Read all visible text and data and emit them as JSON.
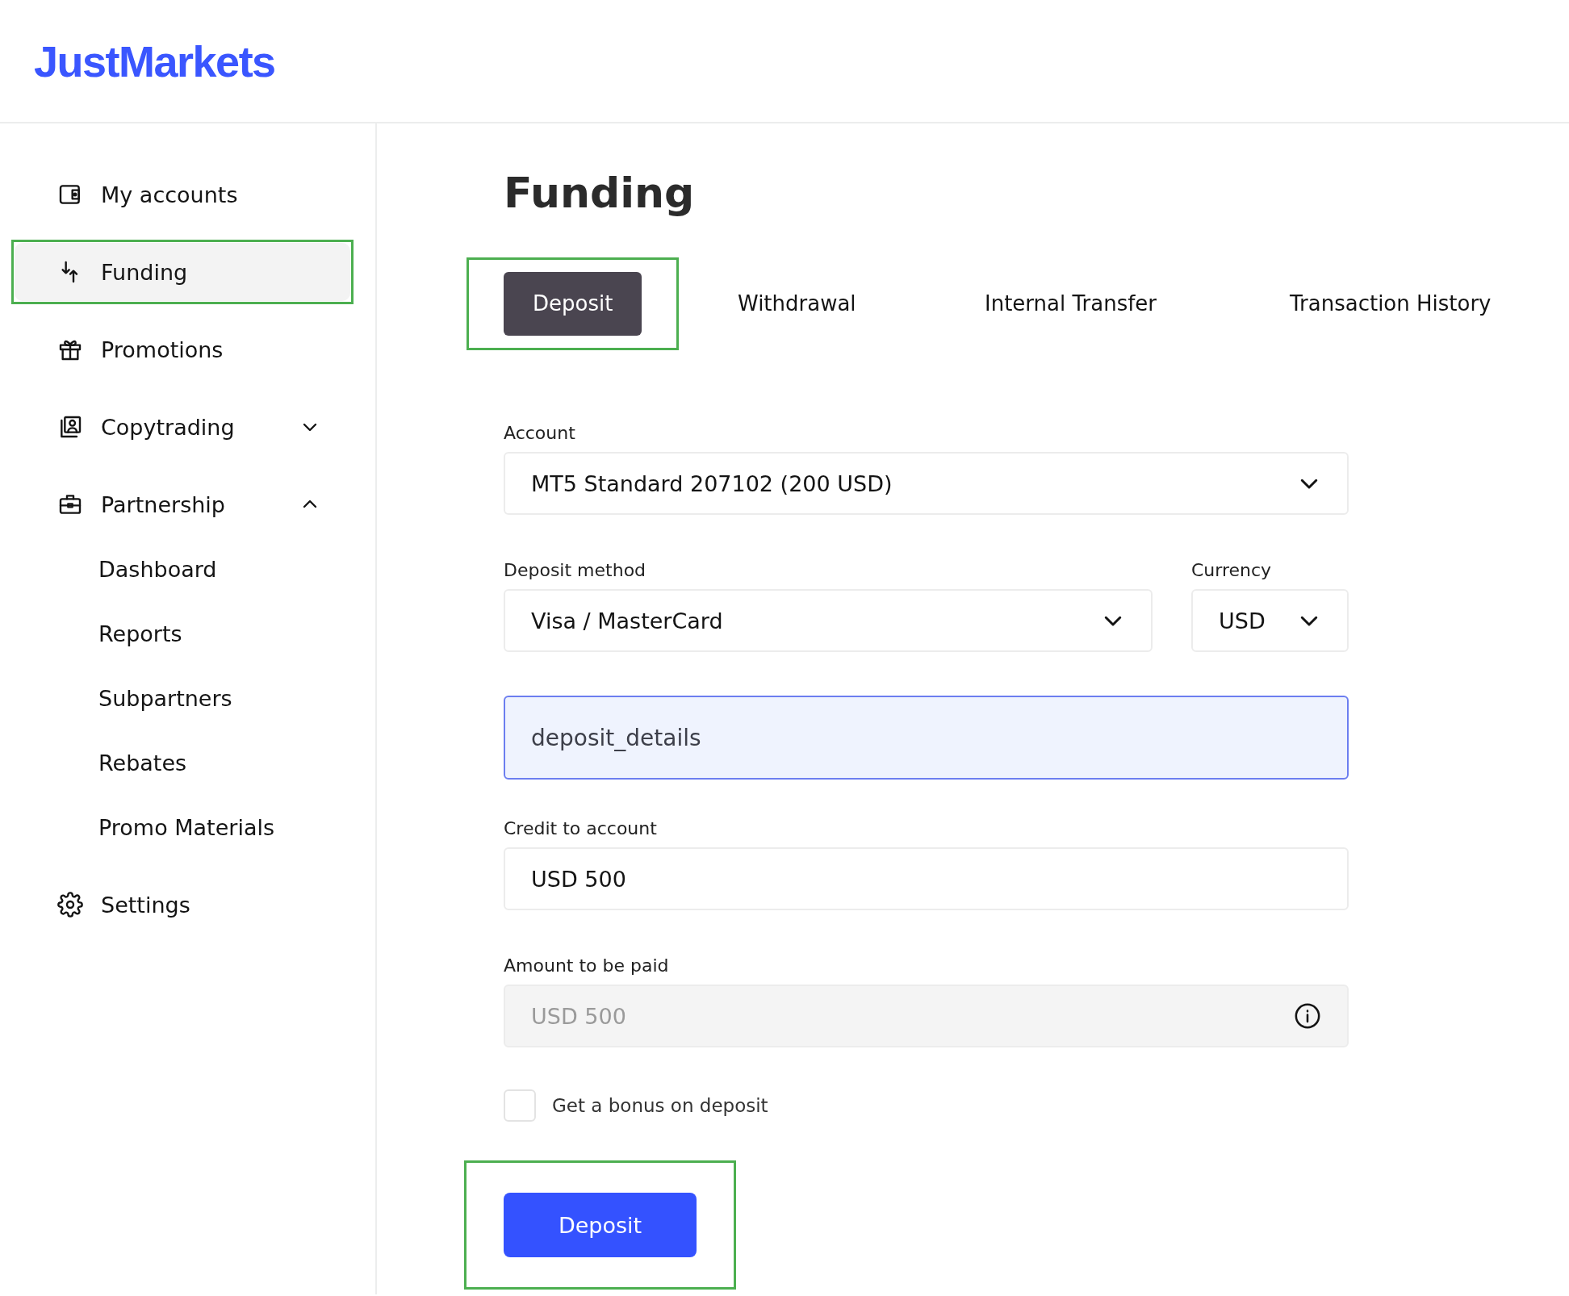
{
  "logo": "JustMarkets",
  "sidebar": {
    "items": [
      {
        "label": "My accounts",
        "selected": false,
        "highlighted": false
      },
      {
        "label": "Funding",
        "selected": true,
        "highlighted": true
      },
      {
        "label": "Promotions",
        "selected": false,
        "highlighted": false
      },
      {
        "label": "Copytrading",
        "selected": false,
        "highlighted": false,
        "expanded": false
      },
      {
        "label": "Partnership",
        "selected": false,
        "highlighted": false,
        "expanded": true,
        "children": [
          {
            "label": "Dashboard"
          },
          {
            "label": "Reports"
          },
          {
            "label": "Subpartners"
          },
          {
            "label": "Rebates"
          },
          {
            "label": "Promo Materials"
          }
        ]
      },
      {
        "label": "Settings",
        "selected": false,
        "highlighted": false
      }
    ]
  },
  "page_title": "Funding",
  "tabs": [
    {
      "label": "Deposit",
      "selected": true,
      "highlighted": true
    },
    {
      "label": "Withdrawal",
      "selected": false,
      "highlighted": false
    },
    {
      "label": "Internal Transfer",
      "selected": false,
      "highlighted": false
    },
    {
      "label": "Transaction History",
      "selected": false,
      "highlighted": false
    }
  ],
  "form": {
    "account": {
      "label": "Account",
      "value": "MT5 Standard 207102 (200 USD)"
    },
    "deposit_method": {
      "label": "Deposit method",
      "value": "Visa / MasterCard"
    },
    "currency": {
      "label": "Currency",
      "value": "USD"
    },
    "details": {
      "value": "deposit_details"
    },
    "credit": {
      "label": "Credit to account",
      "value": "USD 500"
    },
    "amount": {
      "label": "Amount to be paid",
      "value": "USD 500",
      "disabled": true
    },
    "bonus": {
      "label": "Get a bonus on deposit",
      "checked": false
    },
    "submit": {
      "label": "Deposit",
      "highlighted": true
    }
  }
}
